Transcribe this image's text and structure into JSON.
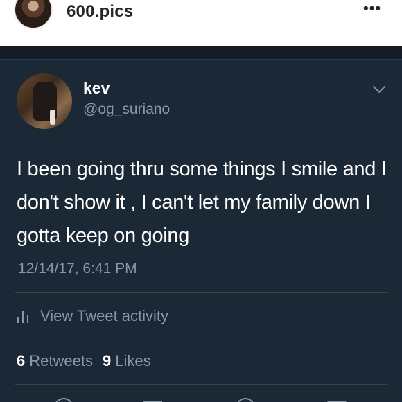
{
  "instagram": {
    "username": "600.pics",
    "more_icon": "more-dots-icon",
    "more_glyph": "•••"
  },
  "tweet": {
    "author_name": "kev",
    "author_handle": "@og_suriano",
    "text": "I been going thru some things I smile and I don't show it , I can't let my family down I gotta keep on going",
    "timestamp": "12/14/17, 6:41 PM",
    "activity_label": "View Tweet activity",
    "retweets_count": "6",
    "retweets_label": "Retweets",
    "likes_count": "9",
    "likes_label": "Likes"
  },
  "colors": {
    "background": "#1b2836",
    "secondary_text": "#8899a6",
    "divider": "#38444d"
  }
}
